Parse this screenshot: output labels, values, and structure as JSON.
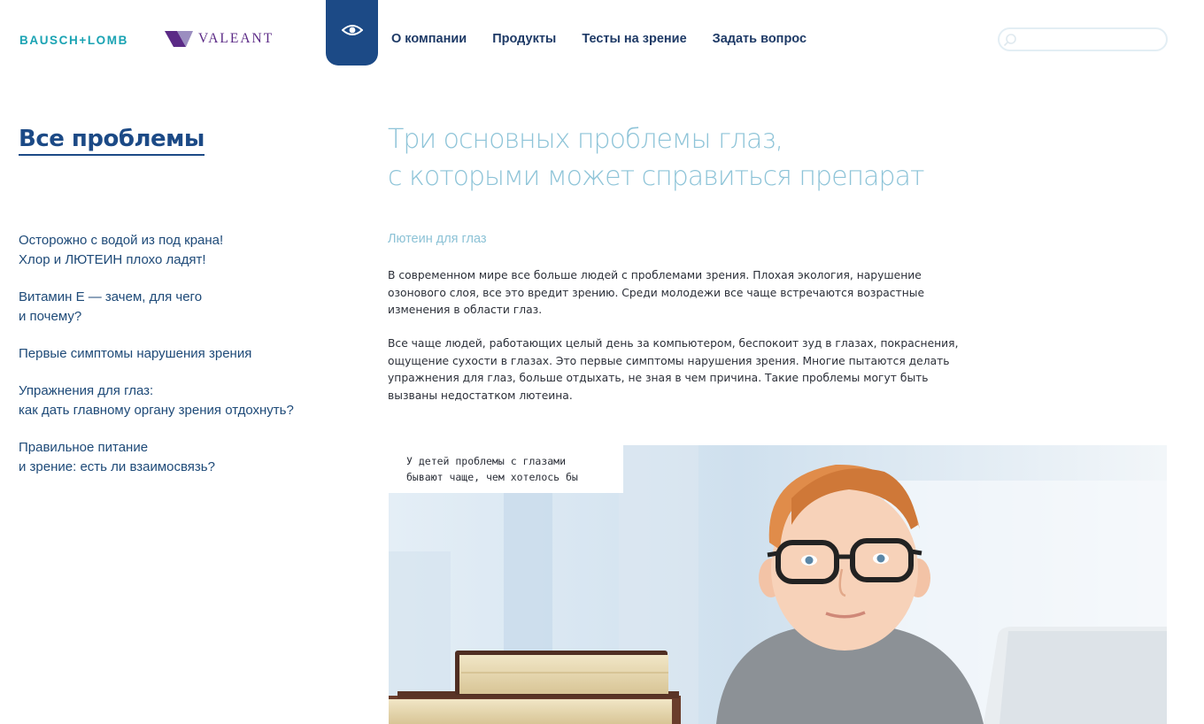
{
  "header": {
    "logo_primary": "BAUSCH+LOMB",
    "logo_secondary": "VALEANT",
    "eye_icon": "eye-icon",
    "nav": [
      {
        "label": "О компании"
      },
      {
        "label": "Продукты"
      },
      {
        "label": "Тесты на зрение"
      },
      {
        "label": "Задать вопрос"
      }
    ],
    "search": {
      "placeholder": "",
      "value": "",
      "icon": "search-icon"
    }
  },
  "sidebar": {
    "title": "Все проблемы",
    "items": [
      {
        "label": "Осторожно с водой из под крана!\nХлор и ЛЮТЕИН плохо ладят!"
      },
      {
        "label": "Витамин Е — зачем, для чего\nи почему?"
      },
      {
        "label": "Первые симптомы нарушения зрения"
      },
      {
        "label": "Упражнения для глаз:\nкак дать главному органу зрения отдохнуть?"
      },
      {
        "label": "Правильное питание\nи зрение: есть ли взаимосвязь?"
      }
    ]
  },
  "main": {
    "heading": "Три основных проблемы глаз,\nс которыми может справиться препарат",
    "subheading": "Лютеин для глаз",
    "paragraph1": "В современном мире все больше людей с проблемами зрения. Плохая экология, нарушение озонового слоя, все это вредит зрению. Среди молодежи все чаще встречаются возрастные изменения в области глаз.",
    "paragraph2": "Все чаще людей, работающих целый день за компьютером, беспокоит зуд в глазах, покраснения, ощущение сухости в глазах. Это первые симптомы нарушения зрения. Многие пытаются делать упражнения для глаз, больше отдыхать, не зная в чем причина. Такие проблемы могут быть вызваны недостатком лютеина.",
    "photo_caption": "У детей проблемы с глазами\nбывают чаще, чем хотелось бы"
  },
  "colors": {
    "brand_blue": "#1c4a86",
    "teal": "#1aa3b3",
    "heading_light_blue": "#8ec4d8",
    "valeant_purple": "#5b2a86"
  }
}
